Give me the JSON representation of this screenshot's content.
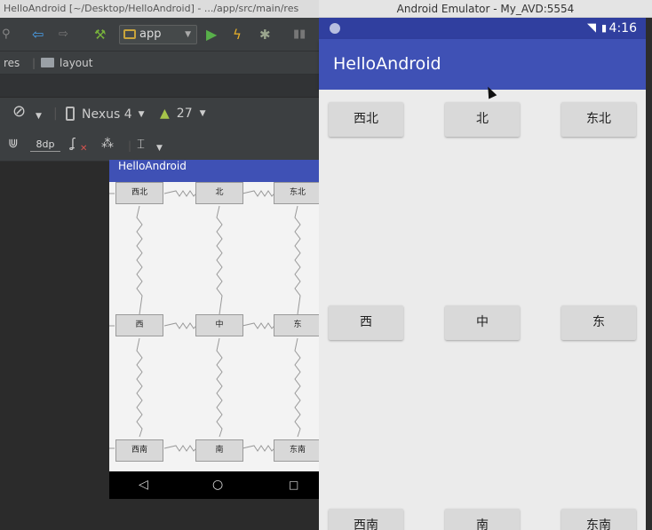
{
  "studio": {
    "window_title": "HelloAndroid [~/Desktop/HelloAndroid] - .../app/src/main/res",
    "run_config": "app",
    "breadcrumb": [
      "res",
      "layout"
    ],
    "device": "Nexus 4",
    "api_level": "27",
    "default_margin": "8dp",
    "preview": {
      "app_title": "HelloAndroid",
      "buttons": [
        "西北",
        "北",
        "东北",
        "西",
        "中",
        "东",
        "西南",
        "南",
        "东南"
      ],
      "nav": {
        "back": "◁",
        "home": "○",
        "recents": "□"
      }
    }
  },
  "emulator": {
    "window_title": "Android Emulator - My_AVD:5554",
    "clock": "4:16",
    "app_title": "HelloAndroid",
    "buttons": [
      "西北",
      "北",
      "东北",
      "西",
      "中",
      "东",
      "西南",
      "南",
      "东南"
    ]
  },
  "colors": {
    "primary": "#3f51b5",
    "primary_dark": "#303f9f",
    "ide_bg": "#2b2b2b",
    "ide_toolbar": "#3c3f41"
  }
}
